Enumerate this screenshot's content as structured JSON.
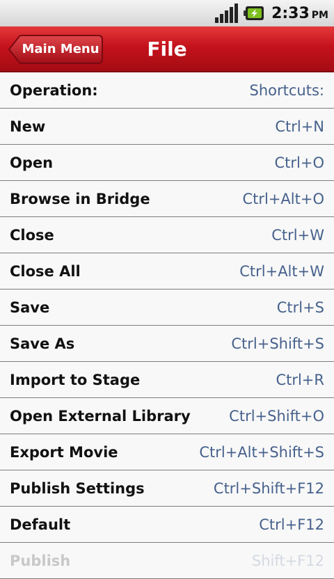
{
  "status_bar": {
    "time": "2:33",
    "ampm": "PM"
  },
  "header": {
    "back_label": "Main Menu",
    "title": "File"
  },
  "list_header": {
    "operation": "Operation:",
    "shortcuts": "Shortcuts:"
  },
  "rows": [
    {
      "op": "New",
      "sc": "Ctrl+N"
    },
    {
      "op": "Open",
      "sc": "Ctrl+O"
    },
    {
      "op": "Browse in Bridge",
      "sc": "Ctrl+Alt+O"
    },
    {
      "op": "Close",
      "sc": "Ctrl+W"
    },
    {
      "op": "Close All",
      "sc": "Ctrl+Alt+W"
    },
    {
      "op": "Save",
      "sc": "Ctrl+S"
    },
    {
      "op": "Save As",
      "sc": "Ctrl+Shift+S"
    },
    {
      "op": "Import to Stage",
      "sc": "Ctrl+R"
    },
    {
      "op": "Open External Library",
      "sc": "Ctrl+Shift+O"
    },
    {
      "op": "Export Movie",
      "sc": "Ctrl+Alt+Shift+S"
    },
    {
      "op": "Publish Settings",
      "sc": "Ctrl+Shift+F12"
    },
    {
      "op": "Default",
      "sc": "Ctrl+F12"
    },
    {
      "op": "Publish",
      "sc": "Shift+F12"
    }
  ],
  "colors": {
    "header_red": "#c4121c",
    "shortcut_blue": "#46618c",
    "battery_green": "#7ec01e"
  },
  "icons": [
    "signal-strength-icon",
    "battery-charging-icon",
    "back-arrow-icon"
  ]
}
